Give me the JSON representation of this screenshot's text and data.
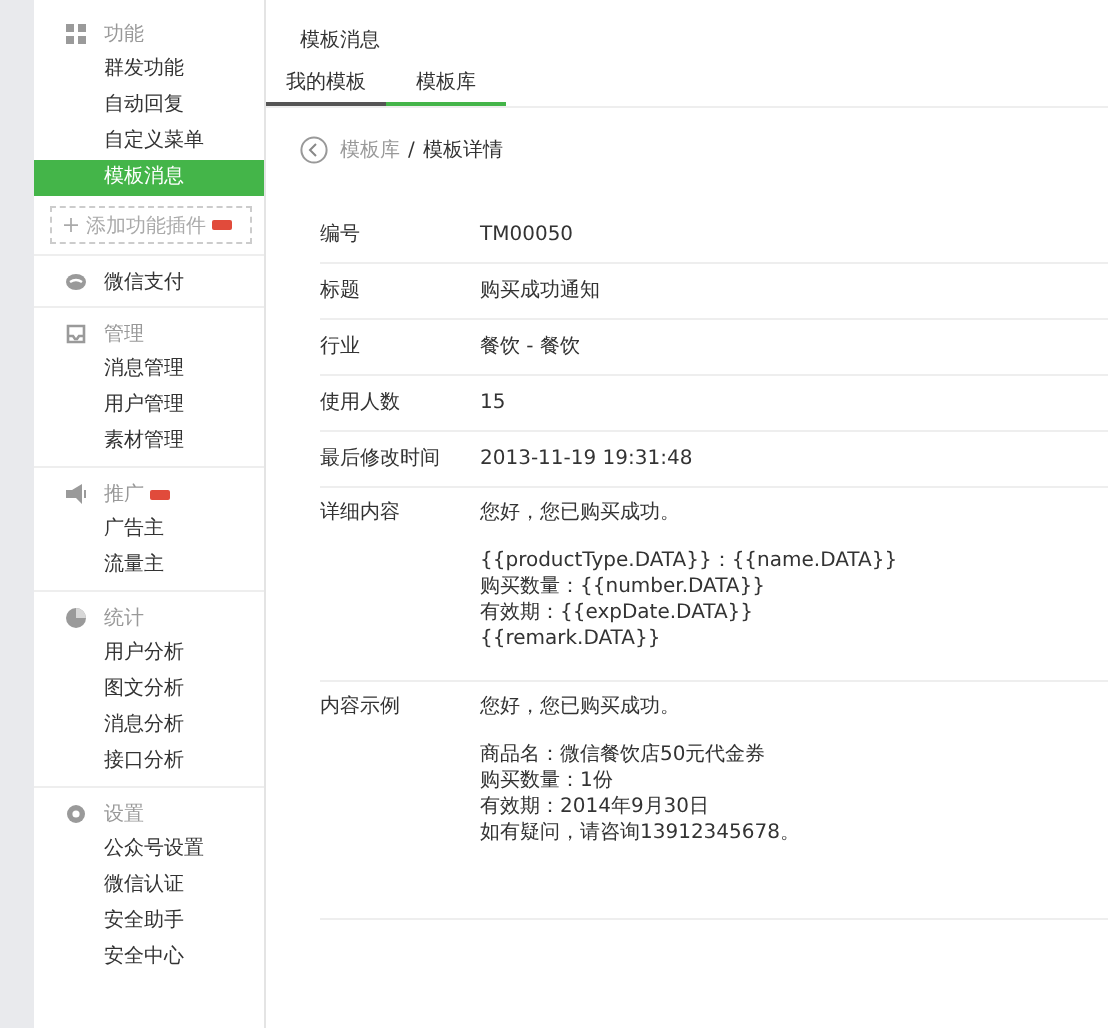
{
  "sidebar": {
    "sections": [
      {
        "title": "功能",
        "items": [
          {
            "label": "群发功能",
            "selected": false
          },
          {
            "label": "自动回复",
            "selected": false
          },
          {
            "label": "自定义菜单",
            "selected": false
          },
          {
            "label": "模板消息",
            "selected": true
          }
        ],
        "add_plugin_button": {
          "label": "添加功能插件",
          "new_badge": true
        }
      },
      {
        "title": "微信支付"
      },
      {
        "title": "管理",
        "items": [
          {
            "label": "消息管理",
            "selected": false
          },
          {
            "label": "用户管理",
            "selected": false
          },
          {
            "label": "素材管理",
            "selected": false
          }
        ]
      },
      {
        "title": "推广",
        "new_badge": true,
        "items": [
          {
            "label": "广告主",
            "selected": false
          },
          {
            "label": "流量主",
            "selected": false
          }
        ]
      },
      {
        "title": "统计",
        "items": [
          {
            "label": "用户分析",
            "selected": false
          },
          {
            "label": "图文分析",
            "selected": false
          },
          {
            "label": "消息分析",
            "selected": false
          },
          {
            "label": "接口分析",
            "selected": false
          }
        ]
      },
      {
        "title": "设置",
        "items": [
          {
            "label": "公众号设置",
            "selected": false
          },
          {
            "label": "微信认证",
            "selected": false
          },
          {
            "label": "安全助手",
            "selected": false
          },
          {
            "label": "安全中心",
            "selected": false
          }
        ]
      }
    ]
  },
  "page_title": "模板消息",
  "tabs": [
    {
      "label": "我的模板",
      "selected": false
    },
    {
      "label": "模板库",
      "selected": true
    }
  ],
  "breadcrumb": {
    "link": "模板库",
    "separator": "/",
    "current": "模板详情"
  },
  "details": [
    {
      "label": "编号",
      "paragraphs": [
        [
          "TM00050"
        ]
      ]
    },
    {
      "label": "标题",
      "paragraphs": [
        [
          "购买成功通知"
        ]
      ]
    },
    {
      "label": "行业",
      "paragraphs": [
        [
          "餐饮 - 餐饮"
        ]
      ]
    },
    {
      "label": "使用人数",
      "paragraphs": [
        [
          "15"
        ]
      ]
    },
    {
      "label": "最后修改时间",
      "paragraphs": [
        [
          "2013-11-19 19:31:48"
        ]
      ]
    },
    {
      "label": "详细内容",
      "paragraphs": [
        [
          "您好，您已购买成功。"
        ],
        [
          "{{productType.DATA}}：{{name.DATA}}",
          "购买数量：{{number.DATA}}",
          "有效期：{{expDate.DATA}}",
          "{{remark.DATA}}"
        ]
      ]
    },
    {
      "label": "内容示例",
      "paragraphs": [
        [
          "您好，您已购买成功。"
        ],
        [
          "商品名：微信餐饮店50元代金券",
          "购买数量：1份",
          "有效期：2014年9月30日",
          "如有疑问，请咨询13912345678。"
        ]
      ]
    }
  ]
}
